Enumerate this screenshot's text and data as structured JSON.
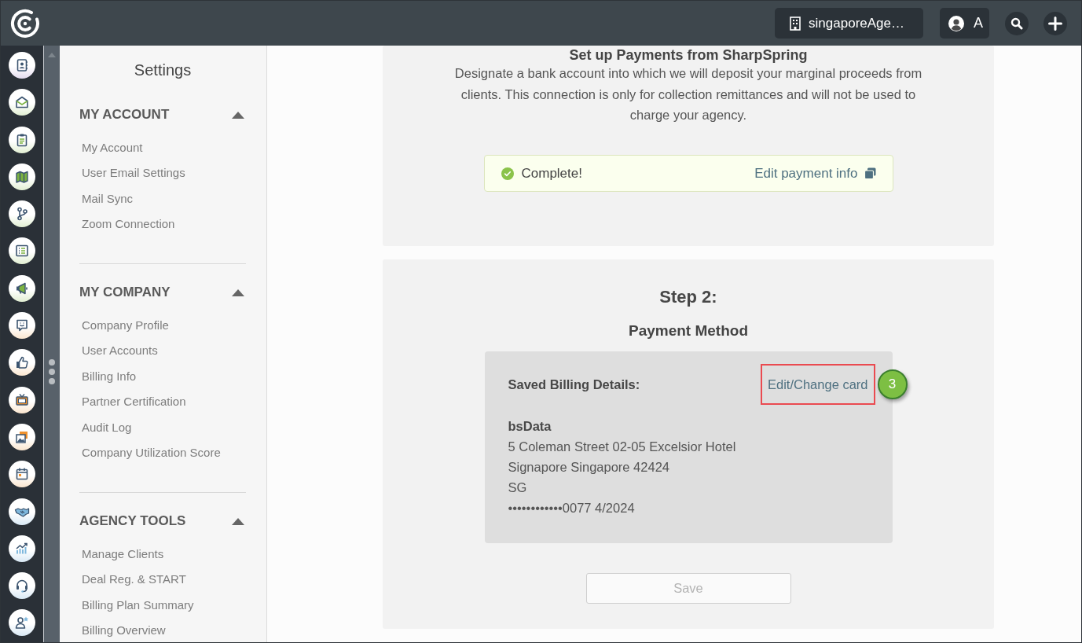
{
  "topbar": {
    "account": "singaporeAge…",
    "user_initial": "A"
  },
  "sidebar": {
    "title": "Settings",
    "sections": [
      {
        "label": "MY ACCOUNT",
        "expanded": true,
        "items": [
          "My Account",
          "User Email Settings",
          "Mail Sync",
          "Zoom Connection"
        ]
      },
      {
        "label": "MY COMPANY",
        "expanded": true,
        "items": [
          "Company Profile",
          "User Accounts",
          "Billing Info",
          "Partner Certification",
          "Audit Log",
          "Company Utilization Score"
        ]
      },
      {
        "label": "AGENCY TOOLS",
        "expanded": true,
        "items": [
          "Manage Clients",
          "Deal Reg. & START",
          "Billing Plan Summary",
          "Billing Overview"
        ]
      }
    ]
  },
  "payout": {
    "heading": "Set up Payments from SharpSpring",
    "description": "Designate a bank account into which we will deposit your marginal proceeds from clients. This connection is only for collection remittances and will not be used to charge your agency.",
    "status": {
      "label": "Complete!",
      "complete": true
    },
    "edit_link": "Edit payment info"
  },
  "payment_method": {
    "step": "Step 2:",
    "title": "Payment Method",
    "billing": {
      "label": "Saved Billing Details:",
      "change_link": "Edit/Change card",
      "annotation": {
        "highlighted": true,
        "callout": "3"
      },
      "name": "bsData",
      "lines": [
        "5 Coleman Street 02-05 Excelsior Hotel",
        "Signapore Singapore 42424",
        "SG",
        "••••••••••••0077 4/2024"
      ]
    },
    "save": {
      "label": "Save",
      "disabled": true
    }
  }
}
